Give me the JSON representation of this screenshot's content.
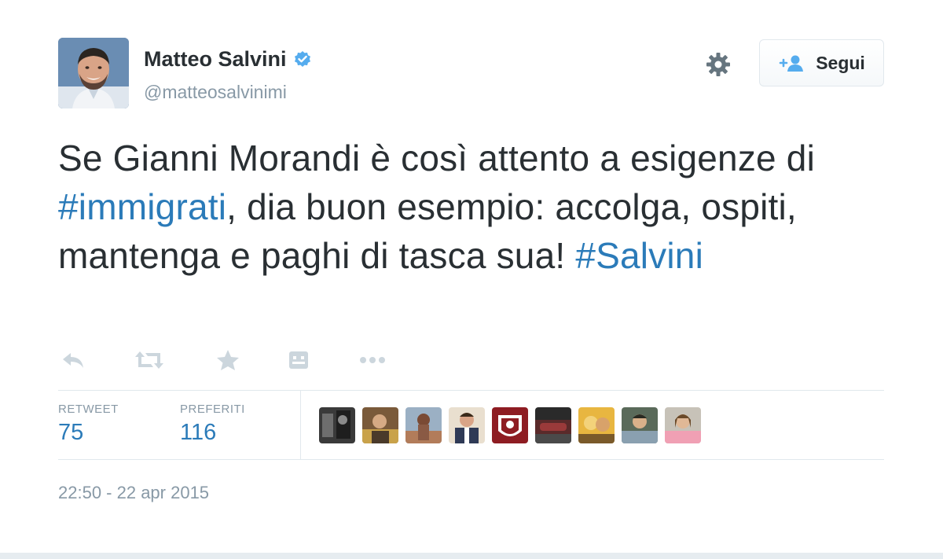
{
  "user": {
    "display_name": "Matteo Salvini",
    "handle": "@matteosalvinimi",
    "verified": true
  },
  "header": {
    "follow_label": "Segui"
  },
  "tweet": {
    "segments": [
      {
        "text": "Se Gianni Morandi è così attento a esigenze di ",
        "type": "text"
      },
      {
        "text": "#immigrati",
        "type": "hashtag"
      },
      {
        "text": ", dia buon esempio: accolga, ospiti, mantenga e paghi di tasca sua! ",
        "type": "text"
      },
      {
        "text": "#Salvini",
        "type": "hashtag"
      }
    ]
  },
  "actions": [
    "reply-icon",
    "retweet-icon",
    "favorite-icon",
    "card-icon",
    "more-icon"
  ],
  "stats": {
    "retweets_label": "RETWEET",
    "retweets_value": "75",
    "favorites_label": "PREFERITI",
    "favorites_value": "116"
  },
  "favoriters_count_shown": 9,
  "timestamp": "22:50 - 22 apr 2015",
  "colors": {
    "text": "#292f33",
    "muted": "#8899a6",
    "link": "#2b7bb9",
    "verified": "#55acee",
    "border": "#e1e8ed"
  }
}
